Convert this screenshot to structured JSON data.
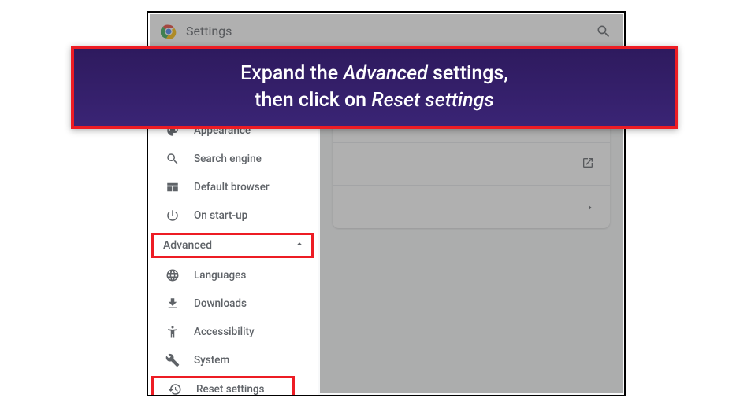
{
  "header": {
    "title": "Settings"
  },
  "sidebar": {
    "items": [
      {
        "label": "Appearance",
        "icon": "appearance"
      },
      {
        "label": "Search engine",
        "icon": "search"
      },
      {
        "label": "Default browser",
        "icon": "browser"
      },
      {
        "label": "On start-up",
        "icon": "power"
      }
    ],
    "advanced_label": "Advanced",
    "advanced_items": [
      {
        "label": "Languages",
        "icon": "globe"
      },
      {
        "label": "Downloads",
        "icon": "download"
      },
      {
        "label": "Accessibility",
        "icon": "accessibility"
      },
      {
        "label": "System",
        "icon": "wrench"
      },
      {
        "label": "Reset settings",
        "icon": "reset"
      }
    ]
  },
  "annotation": {
    "line1": "Expand the ",
    "em1": "Advanced",
    "line1b": " settings,",
    "line2": "then click on ",
    "em2": "Reset settings"
  }
}
